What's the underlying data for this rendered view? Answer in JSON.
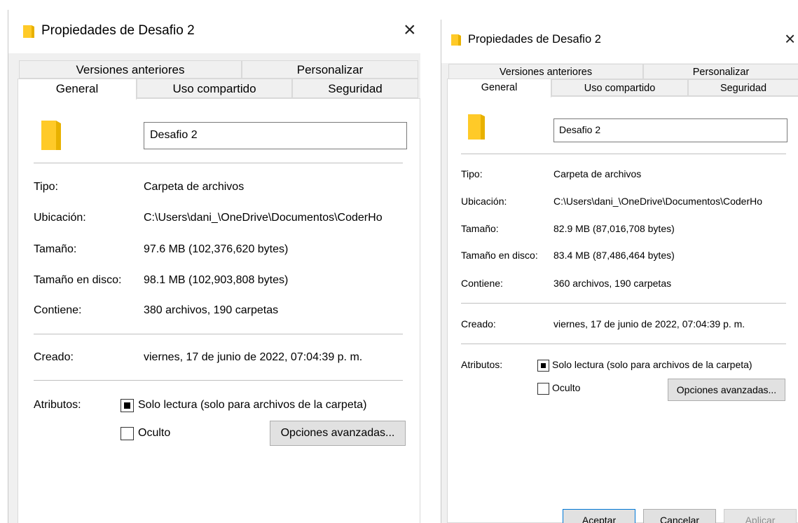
{
  "left_dialog": {
    "title": "Propiedades de Desafio 2",
    "close_symbol": "×",
    "tabs": {
      "previous_versions": "Versiones anteriores",
      "customize": "Personalizar",
      "general": "General",
      "sharing": "Uso compartido",
      "security": "Seguridad"
    },
    "name_value": "Desafio 2",
    "labels": {
      "type": "Tipo:",
      "location": "Ubicación:",
      "size": "Tamaño:",
      "size_on_disk": "Tamaño en disco:",
      "contains": "Contiene:",
      "created": "Creado:",
      "attributes": "Atributos:"
    },
    "values": {
      "type": "Carpeta de archivos",
      "location": "C:\\Users\\dani_\\OneDrive\\Documentos\\CoderHo",
      "size": "97.6 MB (102,376,620 bytes)",
      "size_on_disk": "98.1 MB (102,903,808 bytes)",
      "contains": "380 archivos, 190 carpetas",
      "created": "viernes, 17 de junio de 2022, 07:04:39 p. m."
    },
    "attributes": {
      "readonly_label": "Solo lectura (solo para archivos de la carpeta)",
      "readonly_state": "indeterminate",
      "hidden_label": "Oculto",
      "hidden_checked": false,
      "advanced_button": "Opciones avanzadas..."
    }
  },
  "right_dialog": {
    "title": "Propiedades de Desafio 2",
    "close_symbol": "×",
    "tabs": {
      "previous_versions": "Versiones anteriores",
      "customize": "Personalizar",
      "general": "General",
      "sharing": "Uso compartido",
      "security": "Seguridad"
    },
    "name_value": "Desafio 2",
    "labels": {
      "type": "Tipo:",
      "location": "Ubicación:",
      "size": "Tamaño:",
      "size_on_disk": "Tamaño en disco:",
      "contains": "Contiene:",
      "created": "Creado:",
      "attributes": "Atributos:"
    },
    "values": {
      "type": "Carpeta de archivos",
      "location": "C:\\Users\\dani_\\OneDrive\\Documentos\\CoderHo",
      "size": "82.9 MB (87,016,708 bytes)",
      "size_on_disk": "83.4 MB (87,486,464 bytes)",
      "contains": "360 archivos, 190 carpetas",
      "created": "viernes, 17 de junio de 2022, 07:04:39 p. m."
    },
    "attributes": {
      "readonly_label": "Solo lectura (solo para archivos de la carpeta)",
      "readonly_state": "indeterminate",
      "hidden_label": "Oculto",
      "hidden_checked": false,
      "advanced_button": "Opciones avanzadas..."
    },
    "buttons": {
      "ok": "Aceptar",
      "cancel": "Cancelar",
      "apply": "Aplicar",
      "apply_enabled": false
    }
  },
  "icons": {
    "folder_small": "folder-icon",
    "folder_large": "folder-icon",
    "close": "close-icon"
  },
  "colors": {
    "folder_yellow": "#FFCA28",
    "folder_shade": "#E8B100",
    "dialog_bg": "#F0F0F0",
    "panel_bg": "#FFFFFF",
    "accent_blue": "#0078D7"
  }
}
